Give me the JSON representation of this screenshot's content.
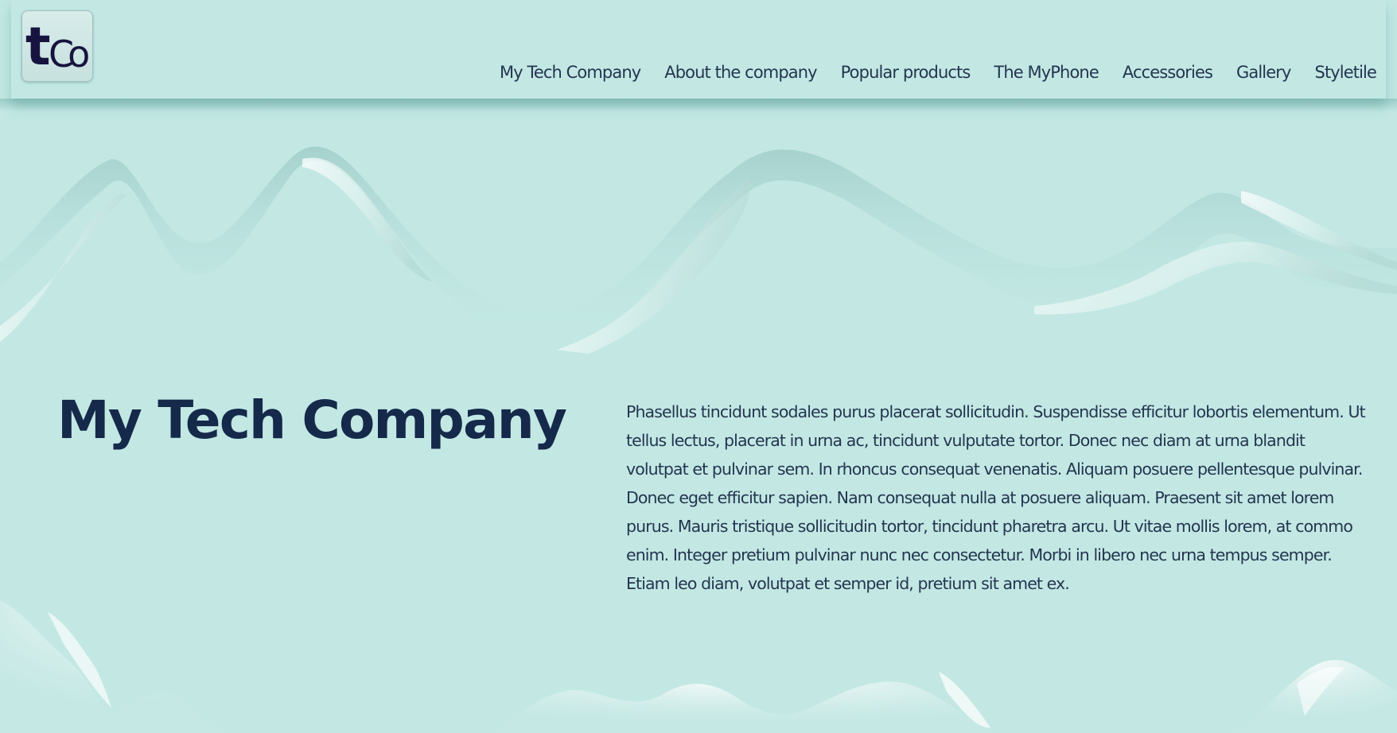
{
  "logo": {
    "text": "tCo",
    "icon": "tco-logo-icon"
  },
  "nav": {
    "items": [
      {
        "label": "My Tech Company"
      },
      {
        "label": "About the company"
      },
      {
        "label": "Popular products"
      },
      {
        "label": "The MyPhone"
      },
      {
        "label": "Accessories"
      },
      {
        "label": "Gallery"
      },
      {
        "label": "Styletile"
      }
    ]
  },
  "hero": {
    "title": "My Tech Company",
    "text": "Phasellus tincidunt sodales purus placerat sollicitudin. Suspendisse efficitur lobortis elementum. Ut tellus lectus, placerat in urna ac, tincidunt vulputate tortor. Donec nec diam at urna blandit volutpat et pulvinar sem. In rhoncus consequat venenatis. Aliquam posuere pellentesque pulvinar. Donec eget efficitur sapien. Nam consequat nulla at posuere aliquam. Praesent sit amet lorem purus. Mauris tristique sollicitudin tortor, tincidunt pharetra arcu. Ut vitae mollis lorem, at commo enim. Integer pretium pulvinar nunc nec consectetur. Morbi in libero nec urna tempus semper. Etiam leo diam, volutpat et semper id, pretium sit amet ex."
  },
  "colors": {
    "background": "#c3e8e4",
    "text_dark": "#15294a",
    "nav_text": "#23354f"
  }
}
